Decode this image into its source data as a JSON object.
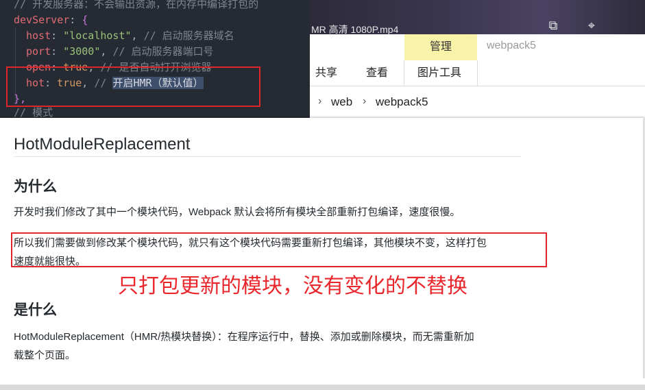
{
  "editor": {
    "line0_comment": "// 开发服务器：不会输出资源，在内存中编译打包的",
    "line1_key": "devServer",
    "line2": {
      "key": "host",
      "value": "\"localhost\"",
      "comment": "// 启动服务器域名"
    },
    "line3": {
      "key": "port",
      "value": "\"3000\"",
      "comment": "// 启动服务器端口号"
    },
    "line4": {
      "key": "open",
      "value": "true",
      "comment": "// 是否自动打开浏览器"
    },
    "line5": {
      "key": "hot",
      "value": "true",
      "comment_prefix": "// ",
      "comment_selected": "开启HMR（默认值）"
    },
    "line6": "},",
    "line7_comment": "// 模式"
  },
  "explorer": {
    "video_title": "MR 高清 1080P.mp4",
    "icons": [
      "share-screen-icon",
      "pin-icon"
    ],
    "context_tab": "管理",
    "context_title": "webpack5",
    "tabs": [
      "共享",
      "查看",
      "图片工具"
    ],
    "breadcrumb": [
      "web",
      "webpack5"
    ]
  },
  "doc": {
    "title": "HotModuleReplacement",
    "section1_heading": "为什么",
    "section1_p1": "开发时我们修改了其中一个模块代码，Webpack 默认会将所有模块全部重新打包编译，速度很慢。",
    "section1_p2_line1": "所以我们需要做到修改某个模块代码，就只有这个模块代码需要重新打包编译，其他模块不变，这样打包",
    "section1_p2_line2": "速度就能很快。",
    "annotation": "只打包更新的模块，没有变化的不替换",
    "section2_heading": "是什么",
    "section2_p1_line1": "HotModuleReplacement（HMR/热模块替换）：在程序运行中，替换、添加或删除模块，而无需重新加",
    "section2_p1_line2": "载整个页面。"
  },
  "colors": {
    "annotation": "#e8262b",
    "highlight_box": "#e0262a",
    "context_tab_bg": "#f8f3a8"
  }
}
